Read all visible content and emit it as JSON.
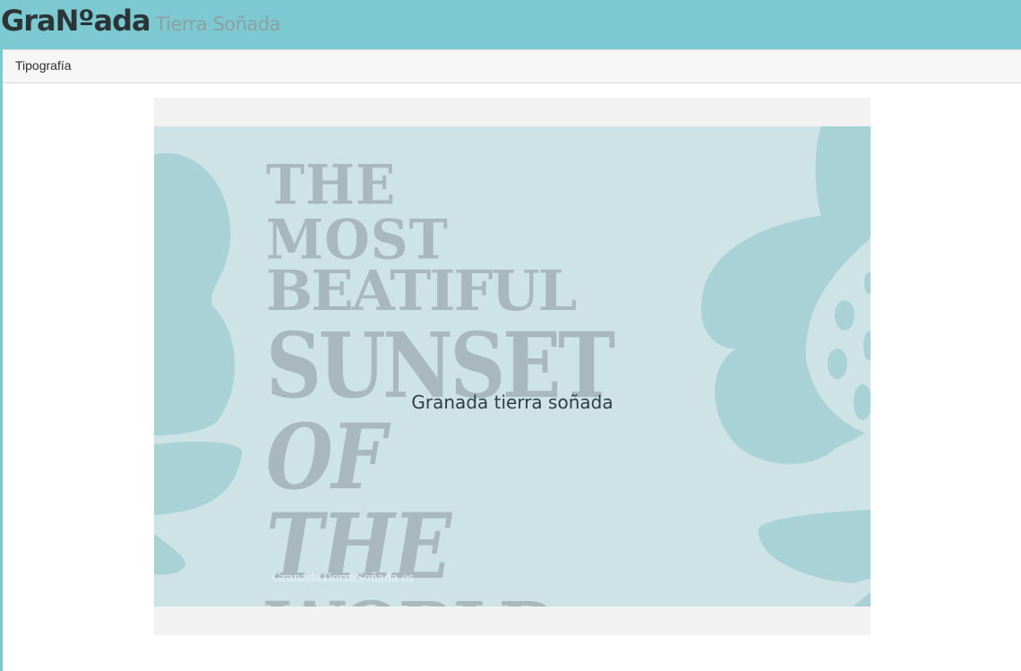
{
  "header": {
    "logo_main": "GraNºada",
    "logo_sub": "Tierra Soñada"
  },
  "nav": {
    "items": [
      {
        "label": "Tipografía"
      }
    ]
  },
  "slide": {
    "caption": "Granada tierra soñada",
    "poster_lines": [
      "THE MOST",
      "BEATIFUL",
      "SUNSET",
      "OF THE",
      "WORLD"
    ],
    "poster_url_text": "GranadaTierraSoñada.es"
  },
  "colors": {
    "header_bg": "#7cc9d1",
    "poster_bg": "#cde3e6",
    "poster_shapes": "#a8d2d6",
    "poster_text": "#a9b8bd"
  }
}
